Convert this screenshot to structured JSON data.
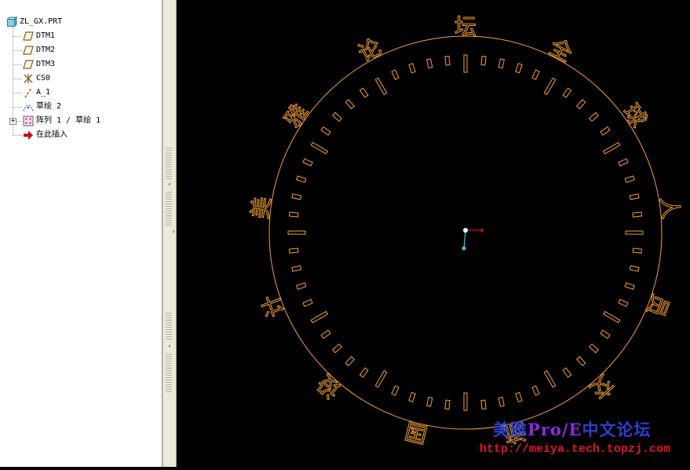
{
  "model_tree": {
    "items": [
      {
        "label": "ZL_GX.PRT",
        "icon": "part-icon"
      },
      {
        "label": "DTM1",
        "icon": "datum-plane-icon"
      },
      {
        "label": "DTM2",
        "icon": "datum-plane-icon"
      },
      {
        "label": "DTM3",
        "icon": "datum-plane-icon"
      },
      {
        "label": "CS0",
        "icon": "coordinate-system-icon"
      },
      {
        "label": "A_1",
        "icon": "datum-axis-icon"
      },
      {
        "label": "草绘 2",
        "icon": "sketch-icon"
      },
      {
        "label": "阵列 1 / 草绘 1",
        "icon": "pattern-icon"
      },
      {
        "label": "在此插入",
        "icon": "insert-here-arrow-icon"
      }
    ]
  },
  "splitter": {
    "collapse_glyph": "‹",
    "expand_glyph": "›"
  },
  "graphics": {
    "tick_count": 60,
    "dial_characters": [
      "坛",
      "全",
      "球",
      "人",
      "员",
      "交",
      "流",
      "国",
      "设",
      "计",
      "美",
      "雅",
      "论"
    ],
    "colors": {
      "sketch": "#f5a030",
      "background": "#000000",
      "csys_point": "#ffffff",
      "csys_axis_x": "#c8102e",
      "csys_axis_y": "#40c8d8"
    }
  },
  "watermark": {
    "title_prefix": "美雅",
    "title_product": "Pro/E",
    "title_suffix": "中文论坛",
    "url": "http://meiya.tech.topzj.com"
  }
}
